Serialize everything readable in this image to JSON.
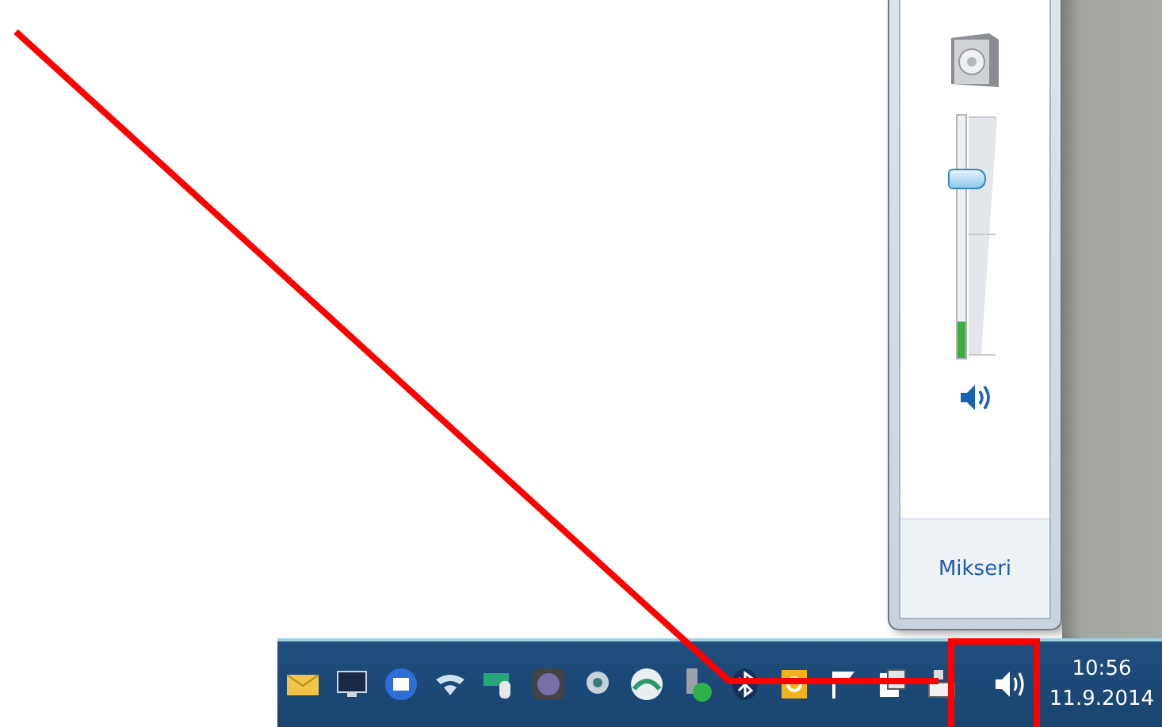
{
  "volume_popup": {
    "volume": {
      "level": 0.74
    },
    "meter": {
      "level": 0.15
    },
    "mute": {
      "on": false
    },
    "mixer_link": "Mikseri"
  },
  "taskbar": {
    "clock": {
      "time": "10:56",
      "date": "11.9.2014"
    }
  },
  "annotation": {
    "kind": "arrow-box"
  }
}
